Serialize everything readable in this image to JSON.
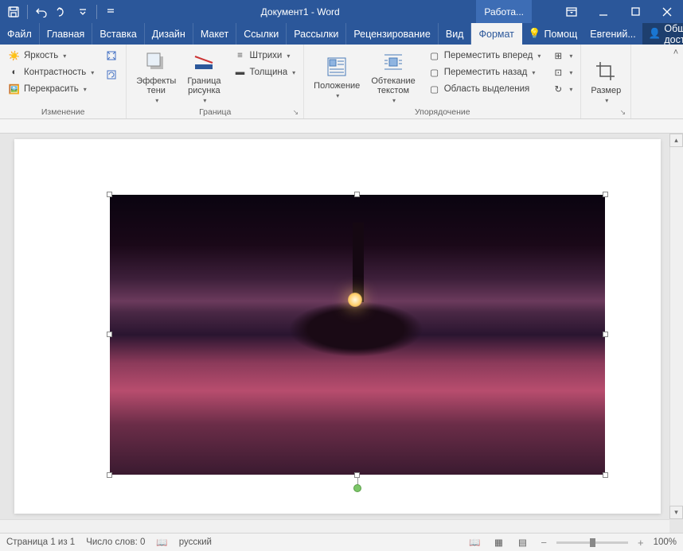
{
  "title": "Документ1 - Word",
  "tool_tab": "Работа...",
  "tabs": {
    "file": "Файл",
    "home": "Главная",
    "insert": "Вставка",
    "design": "Дизайн",
    "layout": "Макет",
    "references": "Ссылки",
    "mailings": "Рассылки",
    "review": "Рецензирование",
    "view": "Вид",
    "format": "Формат",
    "help": "Помощ",
    "user": "Евгений...",
    "share": "Общий доступ"
  },
  "ribbon": {
    "change": {
      "label": "Изменение",
      "brightness": "Яркость",
      "contrast": "Контрастность",
      "recolor": "Перекрасить"
    },
    "border": {
      "label": "Граница",
      "effects": "Эффекты\nтени",
      "picture_border": "Граница\nрисунка",
      "strokes": "Штрихи",
      "thickness": "Толщина"
    },
    "arrange": {
      "label": "Упорядочение",
      "position": "Положение",
      "wrap": "Обтекание\nтекстом",
      "front": "Переместить вперед",
      "back": "Переместить назад",
      "selection": "Область выделения"
    },
    "size": {
      "label": "Размер"
    }
  },
  "status": {
    "page": "Страница 1 из 1",
    "words": "Число слов: 0",
    "lang": "русский",
    "zoom": "100%"
  }
}
